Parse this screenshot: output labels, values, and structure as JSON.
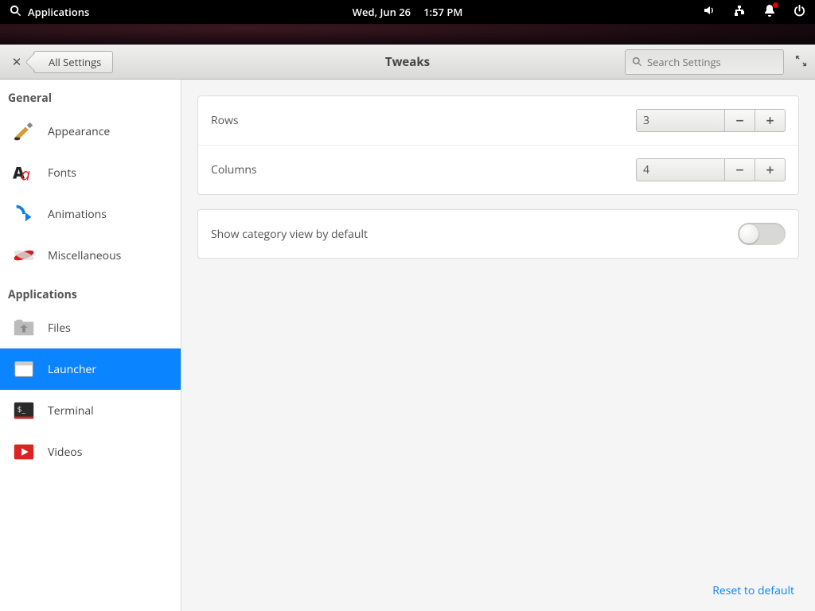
{
  "system_bar": {
    "apps_label": "Applications",
    "date": "Wed, Jun 26",
    "time": "1:57 PM"
  },
  "window": {
    "back_label": "All Settings",
    "title": "Tweaks",
    "search_placeholder": "Search Settings"
  },
  "sidebar": {
    "sections": [
      {
        "title": "General",
        "items": [
          {
            "label": "Appearance",
            "id": "appearance"
          },
          {
            "label": "Fonts",
            "id": "fonts"
          },
          {
            "label": "Animations",
            "id": "animations"
          },
          {
            "label": "Miscellaneous",
            "id": "miscellaneous"
          }
        ]
      },
      {
        "title": "Applications",
        "items": [
          {
            "label": "Files",
            "id": "files"
          },
          {
            "label": "Launcher",
            "id": "launcher",
            "selected": true
          },
          {
            "label": "Terminal",
            "id": "terminal"
          },
          {
            "label": "Videos",
            "id": "videos"
          }
        ]
      }
    ]
  },
  "settings": {
    "rows_label": "Rows",
    "rows_value": "3",
    "columns_label": "Columns",
    "columns_value": "4",
    "category_label": "Show category view by default",
    "category_on": false,
    "reset_label": "Reset to default"
  }
}
